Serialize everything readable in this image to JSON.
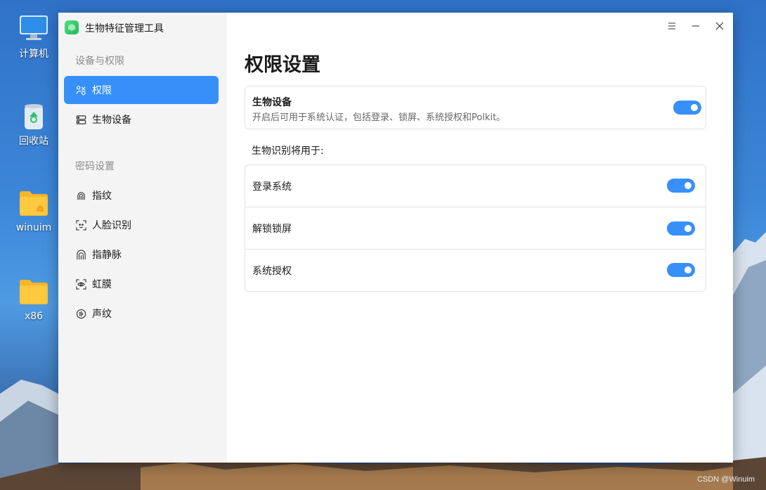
{
  "desktop": {
    "icons": [
      {
        "label": "计算机",
        "icon": "computer-icon"
      },
      {
        "label": "回收站",
        "icon": "trash-icon"
      },
      {
        "label": "winuim",
        "icon": "home-folder-icon"
      },
      {
        "label": "x86",
        "icon": "folder-icon"
      }
    ],
    "watermark": "CSDN @Winuim"
  },
  "window": {
    "app_title": "生物特征管理工具",
    "titlebar": {
      "menu_icon": "menu-icon",
      "minimize_icon": "minimize-icon",
      "close_icon": "close-icon"
    },
    "sidebar": {
      "section_devices": "设备与权限",
      "items_devices": [
        {
          "label": "权限",
          "icon": "permission-icon",
          "active": true
        },
        {
          "label": "生物设备",
          "icon": "device-icon",
          "active": false
        }
      ],
      "section_password": "密码设置",
      "items_password": [
        {
          "label": "指纹",
          "icon": "fingerprint-icon"
        },
        {
          "label": "人脸识别",
          "icon": "face-icon"
        },
        {
          "label": "指静脉",
          "icon": "finger-vein-icon"
        },
        {
          "label": "虹膜",
          "icon": "iris-icon"
        },
        {
          "label": "声纹",
          "icon": "voiceprint-icon"
        }
      ]
    },
    "main": {
      "page_title": "权限设置",
      "biometric_card": {
        "title": "生物设备",
        "description": "开启后可用于系统认证，包括登录、锁屏、系统授权和Polkit。",
        "enabled": true
      },
      "usage_heading": "生物识别将用于:",
      "usage_items": [
        {
          "label": "登录系统",
          "enabled": true
        },
        {
          "label": "解锁锁屏",
          "enabled": true
        },
        {
          "label": "系统授权",
          "enabled": true
        }
      ]
    }
  },
  "colors": {
    "accent": "#3790fa",
    "sidebar_bg": "#f4f4f4"
  }
}
